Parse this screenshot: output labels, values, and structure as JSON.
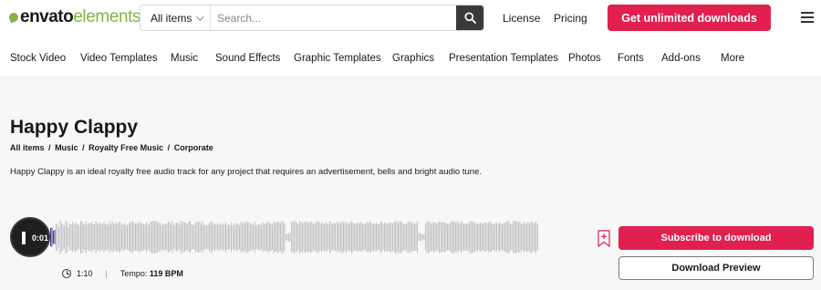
{
  "header": {
    "logo_part1": "envato",
    "logo_part2": "elements",
    "search_category": "All items",
    "search_placeholder": "Search...",
    "links": [
      "License",
      "Pricing"
    ],
    "cta_label": "Get unlimited downloads"
  },
  "nav": {
    "items": [
      "Stock Video",
      "Video Templates",
      "Music",
      "Sound Effects",
      "Graphic Templates",
      "Graphics",
      "Presentation Templates",
      "Photos",
      "Fonts",
      "Add-ons",
      "More"
    ]
  },
  "item": {
    "title": "Happy Clappy",
    "breadcrumbs": [
      "All items",
      "Music",
      "Royalty Free Music",
      "Corporate"
    ],
    "breadcrumb_separator": "/",
    "description": "Happy Clappy is an ideal royalty free audio track for any project that requires an advertisement, bells and bright audio tune.",
    "current_time": "0:01",
    "duration": "1:10",
    "meta_divider": "|",
    "tempo_label": "Tempo:",
    "tempo_value": "119 BPM",
    "progress": 0.01
  },
  "actions": {
    "subscribe_label": "Subscribe to download",
    "preview_label": "Download Preview"
  },
  "colors": {
    "brand_green": "#82b541",
    "cta_red": "#e0204f",
    "waveform_gray": "#c2c2c2",
    "waveform_played": "#3b3b8f"
  },
  "icons": {
    "search": "search-icon",
    "menu": "hamburger-icon",
    "bookmark": "bookmark-add-icon",
    "clock": "clock-icon",
    "chevron": "chevron-down-icon"
  }
}
